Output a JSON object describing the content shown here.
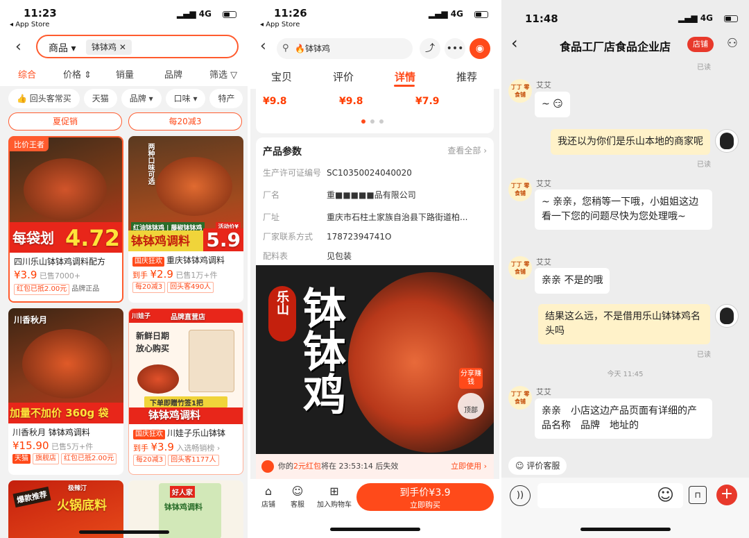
{
  "colors": {
    "accent": "#ff4a1a",
    "accent_light": "#fff0ec",
    "shop_badge": "#e8392b"
  },
  "panel1": {
    "status": {
      "time": "11:23",
      "back": "◂ App Store",
      "signal": "4G"
    },
    "search": {
      "category": "商品 ▾",
      "chip": "钵钵鸡 ✕"
    },
    "sorts": [
      "综合",
      "价格 ⇕",
      "销量",
      "品牌",
      "筛选 ▽"
    ],
    "filters": [
      "👍 回头客常买",
      "天猫",
      "品牌 ▾",
      "口味 ▾",
      "特产"
    ],
    "promos": [
      "夏促销",
      "每20减3"
    ],
    "cards": [
      {
        "badge": "比价王者",
        "overlay1": "每袋划",
        "overlay2": "4.72",
        "title": "四川乐山钵钵鸡调料配方",
        "price": "¥3.9",
        "sold": "已售7000+",
        "tags": [
          "红包已抵2.00元",
          "品牌正品"
        ]
      },
      {
        "overlay1": "钵钵鸡调料",
        "overlay2": "5.9",
        "overlay3": "红油钵钵鸡 | 藤椒钵钵鸡",
        "overlay4": "两种口味可选",
        "badge": "活动价¥",
        "title_tag": "国庆狂欢",
        "title": "重庆钵钵鸡调料",
        "price_prefix": "到手",
        "price": "¥2.9",
        "sold": "已售1万+件",
        "tags": [
          "每20减3",
          "回头客490人"
        ]
      },
      {
        "overlay1": "加量不加价 360g 袋",
        "overlay3": "川香秋月",
        "title": "川香秋月 钵钵鸡调料",
        "price": "¥15.90",
        "sold": "已售5万+件",
        "tags": [
          "天猫",
          "旗舰店",
          "红包已抵2.00元"
        ]
      },
      {
        "badge": "品牌直营店",
        "logo": "川娃子",
        "overlay1": "钵钵鸡调料",
        "overlay3": "新鲜日期",
        "overlay4": "放心购买",
        "overlay5": "下单即赠竹签1把",
        "title_tag": "国庆狂欢",
        "title": "川娃子乐山钵钵",
        "price_prefix": "到手",
        "price": "¥3.9",
        "sold": "入选畅销榜 ›",
        "tags": [
          "每20减3",
          "回头客1177人"
        ]
      },
      {
        "overlay1": "火锅底料",
        "overlay3": "爆款推荐",
        "logo": "极辣汀"
      },
      {
        "overlay1": "钵钵鸡调料",
        "logo": "好人家"
      }
    ]
  },
  "panel2": {
    "status": {
      "time": "11:26",
      "back": "◂ App Store",
      "signal": "4G"
    },
    "search": "🔥钵钵鸡",
    "tabs": [
      "宝贝",
      "评价",
      "详情",
      "推荐"
    ],
    "prices": [
      "¥9.8",
      "¥9.8",
      "¥7.9"
    ],
    "params_title": "产品参数",
    "view_all": "查看全部 ›",
    "params": [
      {
        "k": "生产许可证编号",
        "v": "SC10350024040020"
      },
      {
        "k": "厂名",
        "v": "重■■■■■品有限公司"
      },
      {
        "k": "厂址",
        "v": "重庆市石柱土家族自治县下路街道柏..."
      },
      {
        "k": "厂家联系方式",
        "v": "17872394741O"
      },
      {
        "k": "配料表",
        "v": "见包装"
      }
    ],
    "hero": {
      "small": "乐山",
      "big": "钵钵鸡",
      "share": "分享赚钱",
      "top": "顶部"
    },
    "redpacket": {
      "pre": "你的",
      "amount": "2元红包",
      "mid": "将在",
      "timer": "23:53:14",
      "post": "后失效",
      "cta": "立即使用 ›"
    },
    "bottom": {
      "shop": "店铺",
      "service": "客服",
      "cart": "加入购物车",
      "buy_price": "到手价¥3.9",
      "buy_label": "立即购买"
    }
  },
  "panel3": {
    "status": {
      "time": "11:48",
      "signal": "4G"
    },
    "title": "食品工厂店食品企业店",
    "shop_btn": "店铺",
    "read": "已读",
    "shop_name": "艾艾",
    "shop_avatar": "丁丁 零食铺",
    "timestamp": "今天 11:45",
    "messages": [
      {
        "from": "shop",
        "text": "~ 😏"
      },
      {
        "from": "me",
        "text": "我还以为你们是乐山本地的商家呢"
      },
      {
        "from": "shop",
        "text": "~ 亲亲，您稍等一下哦，小姐姐这边看一下您的问题尽快为您处理哦~"
      },
      {
        "from": "shop",
        "text": "亲亲 不是的哦"
      },
      {
        "from": "me",
        "text": "结果这么远，不是借用乐山钵钵鸡名头吗"
      },
      {
        "from": "shop",
        "text": "亲亲　小店这边产品页面有详细的产品名称　品牌　地址的"
      }
    ],
    "rate": "☺ 评价客服"
  }
}
